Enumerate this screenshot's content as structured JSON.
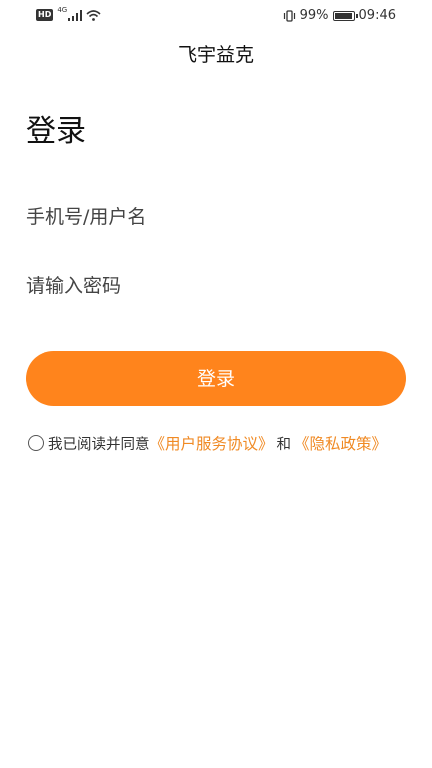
{
  "status_bar": {
    "hd": "HD",
    "network": "4G",
    "battery_percent": "99%",
    "battery_level": 0.99,
    "time": "09:46",
    "icons": [
      "signal-icon",
      "wifi-icon",
      "vibrate-icon",
      "battery-icon"
    ]
  },
  "app": {
    "title": "飞宇益克"
  },
  "login": {
    "heading": "登录",
    "phone_placeholder": "手机号/用户名",
    "password_placeholder": "请输入密码",
    "button_label": "登录"
  },
  "agreement": {
    "prefix": "我已阅读并同意",
    "user_agreement": "《用户服务协议》",
    "and": "和",
    "privacy_policy": "《隐私政策》",
    "checked": false
  },
  "colors": {
    "accent": "#ff841c",
    "link": "#f08a24",
    "background": "#ffffff"
  }
}
